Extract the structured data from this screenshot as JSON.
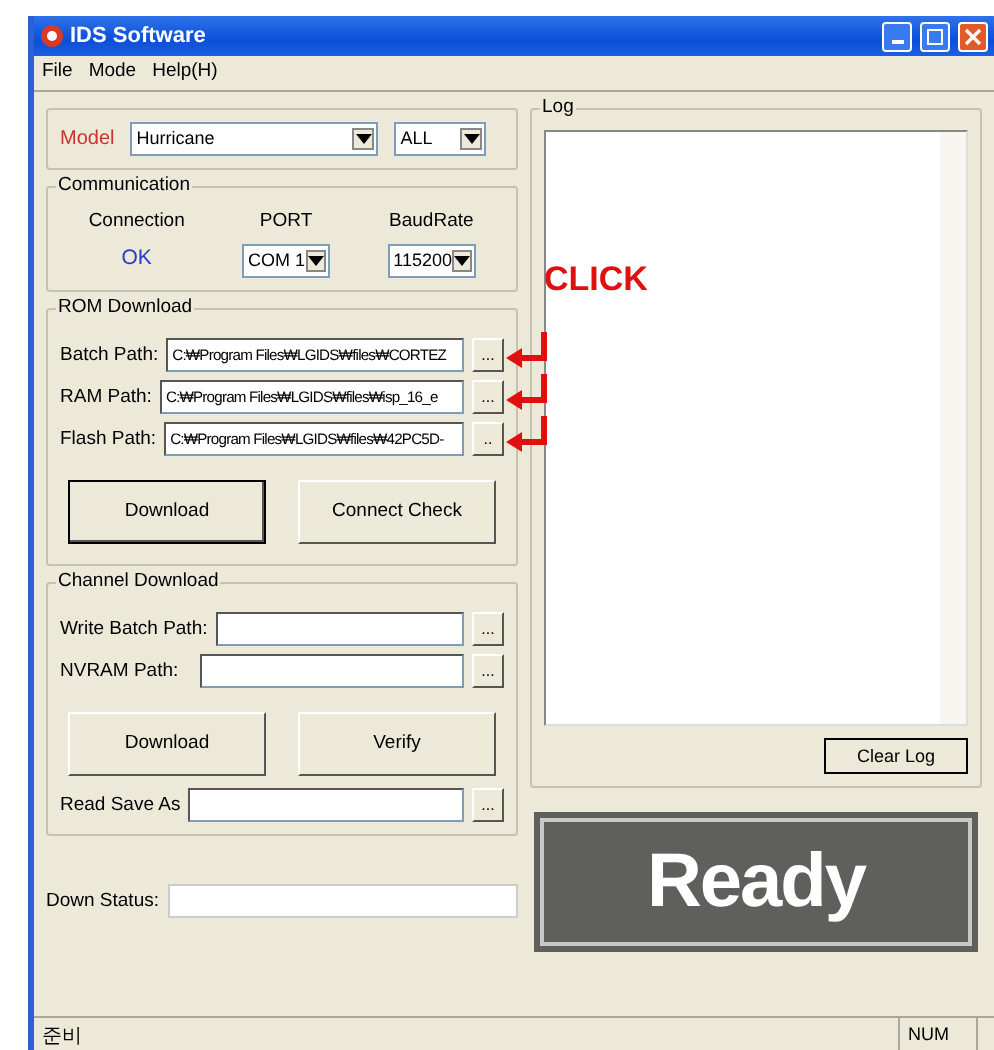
{
  "window": {
    "title": "IDS Software"
  },
  "menu": [
    "File",
    "Mode",
    "Help(H)"
  ],
  "model": {
    "label": "Model",
    "value": "Hurricane",
    "filter": "ALL"
  },
  "communication": {
    "title": "Communication",
    "connection_label": "Connection",
    "connection_value": "OK",
    "port_label": "PORT",
    "port_value": "COM 1",
    "baud_label": "BaudRate",
    "baud_value": "115200"
  },
  "rom_download": {
    "title": "ROM Download",
    "paths": [
      {
        "label": "Batch Path:",
        "value": "C:₩Program Files₩LGIDS₩files₩CORTEZ",
        "button": "...",
        "arrow": true
      },
      {
        "label": "RAM Path:",
        "value": "C:₩Program Files₩LGIDS₩files₩isp_16_e",
        "button": "...",
        "arrow": true
      },
      {
        "label": "Flash Path:",
        "value": "C:₩Program Files₩LGIDS₩files₩42PC5D-",
        "button": "..",
        "arrow": true
      }
    ],
    "buttons": [
      {
        "label": "Download",
        "default": true
      },
      {
        "label": "Connect Check",
        "default": false
      }
    ]
  },
  "channel_download": {
    "title": "Channel Download",
    "paths": [
      {
        "label": "Write Batch Path:",
        "button": "..."
      },
      {
        "label": "NVRAM Path:",
        "button": "..."
      }
    ],
    "buttons": [
      {
        "label": "Download",
        "default": false
      },
      {
        "label": "Verify",
        "default": false
      }
    ],
    "save": {
      "label": "Read Save As",
      "button": "..."
    }
  },
  "down_status": {
    "label": "Down Status:"
  },
  "log": {
    "title": "Log",
    "clear_button": "Clear Log"
  },
  "status_display": "Ready",
  "annotation": {
    "text": "CLICK"
  },
  "status_bar": {
    "left": "준비",
    "right": "NUM"
  }
}
